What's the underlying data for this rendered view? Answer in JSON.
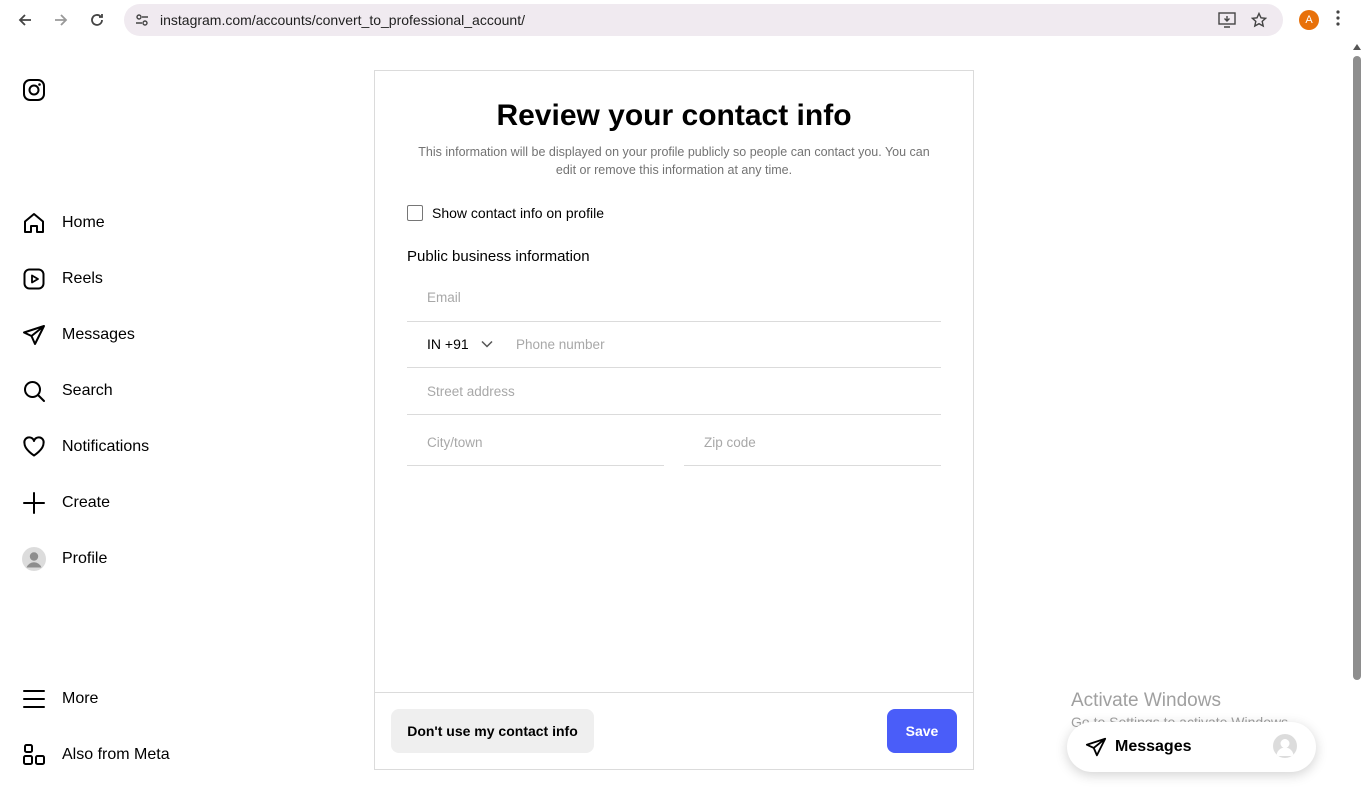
{
  "browser": {
    "url": "instagram.com/accounts/convert_to_professional_account/",
    "profile_initial": "A"
  },
  "sidebar": {
    "items": [
      {
        "label": "Home",
        "icon": "home-icon"
      },
      {
        "label": "Reels",
        "icon": "reels-icon"
      },
      {
        "label": "Messages",
        "icon": "messages-icon"
      },
      {
        "label": "Search",
        "icon": "search-icon"
      },
      {
        "label": "Notifications",
        "icon": "heart-icon"
      },
      {
        "label": "Create",
        "icon": "plus-icon"
      },
      {
        "label": "Profile",
        "icon": "profile-avatar-icon"
      }
    ],
    "bottom": [
      {
        "label": "More",
        "icon": "hamburger-icon"
      },
      {
        "label": "Also from Meta",
        "icon": "meta-apps-icon"
      }
    ]
  },
  "form": {
    "title": "Review your contact info",
    "description": "This information will be displayed on your profile publicly so people can contact you. You can edit or remove this information at any time.",
    "show_contact_label": "Show contact info on profile",
    "section_label": "Public business information",
    "email_placeholder": "Email",
    "country_code": "IN +91",
    "phone_placeholder": "Phone number",
    "street_placeholder": "Street address",
    "city_placeholder": "City/town",
    "zip_placeholder": "Zip code",
    "secondary_button": "Don't use my contact info",
    "primary_button": "Save"
  },
  "watermark": {
    "line1": "Activate Windows",
    "line2": "Go to Settings to activate Windows."
  },
  "messages_widget": {
    "label": "Messages"
  },
  "colors": {
    "primary": "#4a5df9",
    "secondary_bg": "#efefef",
    "border": "#dbdbdb"
  }
}
